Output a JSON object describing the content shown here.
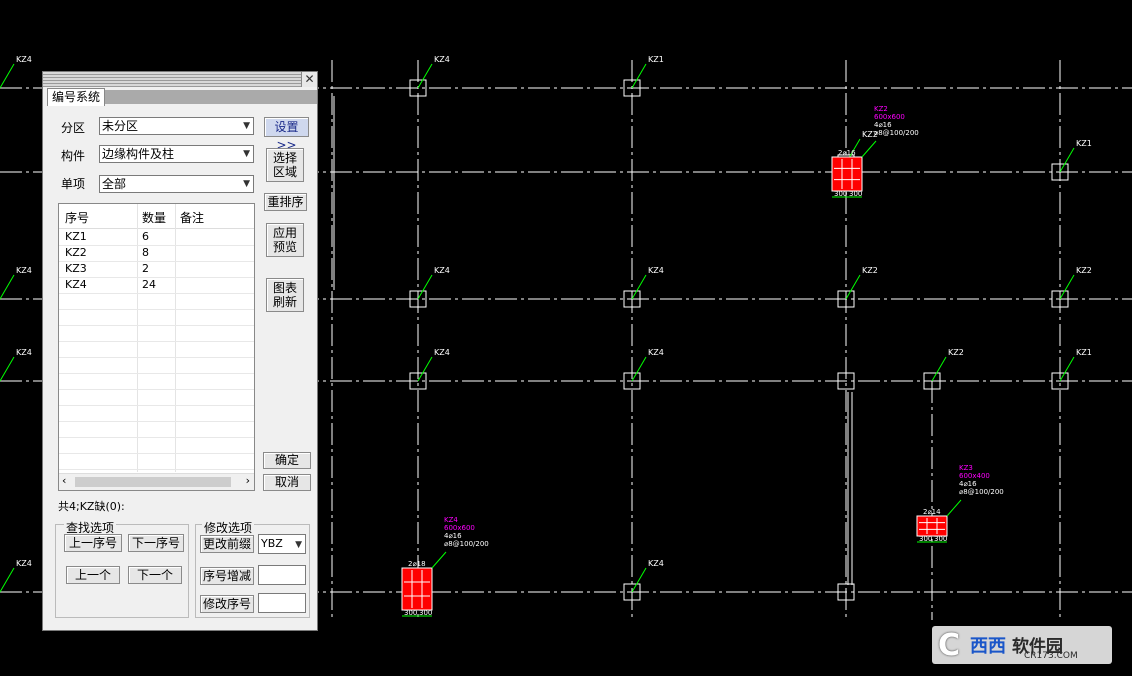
{
  "panel": {
    "tab": "编号系统",
    "close": "✕",
    "labels": {
      "fenqu": "分区",
      "goujian": "构件",
      "danxiang": "单项"
    },
    "combos": {
      "fenqu": "未分区",
      "goujian": "边缘构件及柱",
      "danxiang": "全部"
    },
    "buttons": {
      "settings": "设置>>",
      "select_region": "选择区域",
      "resort": "重排序",
      "apply_preview": "应用预览",
      "refresh_chart": "图表刷新",
      "ok": "确定",
      "cancel": "取消"
    },
    "table": {
      "headers": [
        "序号",
        "数量",
        "备注"
      ],
      "rows": [
        {
          "id": "KZ1",
          "qty": "6",
          "note": ""
        },
        {
          "id": "KZ2",
          "qty": "8",
          "note": ""
        },
        {
          "id": "KZ3",
          "qty": "2",
          "note": ""
        },
        {
          "id": "KZ4",
          "qty": "24",
          "note": ""
        }
      ]
    },
    "status": "共4;KZ缺(0):",
    "find": {
      "title": "查找选项",
      "prev_num": "上一序号",
      "next_num": "下一序号",
      "prev": "上一个",
      "next": "下一个"
    },
    "modify": {
      "title": "修改选项",
      "change_prefix": "更改前缀",
      "prefix_value": "YBZ",
      "seq_inc": "序号增减",
      "change_seq": "修改序号"
    }
  },
  "cad": {
    "colors": {
      "grid": "#ffffff",
      "label": "#ffffff",
      "column": "#ff0000",
      "dim": "#00ff00",
      "note_title": "#ff00ff"
    },
    "column_tags": [
      {
        "text": "KZ4"
      },
      {
        "text": "KZ4"
      },
      {
        "text": "KZ1"
      },
      {
        "text": "KZ2"
      },
      {
        "text": "KZ1"
      },
      {
        "text": "KZ4"
      },
      {
        "text": "KZ4"
      },
      {
        "text": "KZ4"
      },
      {
        "text": "KZ2"
      },
      {
        "text": "KZ2"
      },
      {
        "text": "KZ4"
      },
      {
        "text": "KZ4"
      },
      {
        "text": "KZ4"
      },
      {
        "text": "KZ2"
      },
      {
        "text": "KZ1"
      },
      {
        "text": "KZ4"
      },
      {
        "text": "KZ4"
      }
    ],
    "details": [
      {
        "tag": "KZ2",
        "size": "600x600",
        "bars": "4⌀16",
        "stirrup": "⌀8@100/200",
        "bar_mark": "2⌀16",
        "dims": [
          "300",
          "300"
        ]
      },
      {
        "tag": "KZ4",
        "size": "600x600",
        "bars": "4⌀16",
        "stirrup": "⌀8@100/200",
        "bar_mark": "2⌀18",
        "dims": [
          "300",
          "300"
        ]
      },
      {
        "tag": "KZ3",
        "size": "600x400",
        "bars": "4⌀16",
        "stirrup": "⌀8@100/200",
        "bar_mark": "2⌀14",
        "dims": [
          "300",
          "300"
        ]
      }
    ]
  },
  "watermark": {
    "logo": "C",
    "brand": "西西",
    "text": "软件园",
    "url": "CR173.COM"
  }
}
